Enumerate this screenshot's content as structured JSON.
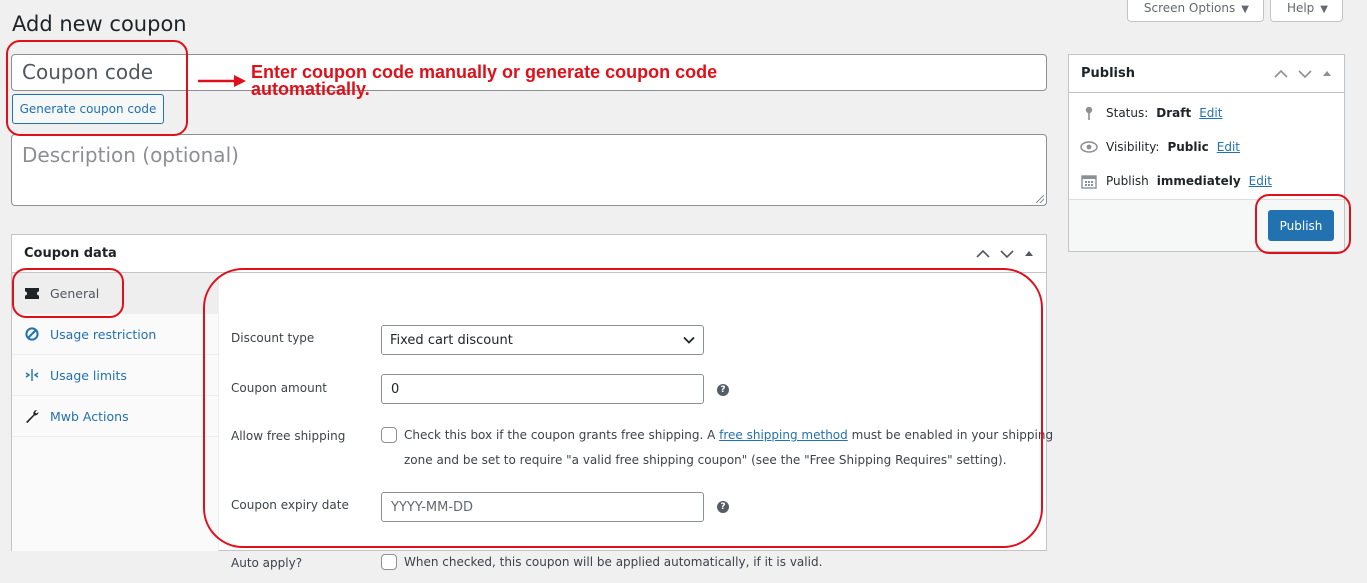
{
  "screen_options": {
    "label": "Screen Options",
    "caret": "▼"
  },
  "help": {
    "label": "Help",
    "caret": "▼"
  },
  "page_title": "Add new coupon",
  "coupon_code": {
    "placeholder": "Coupon code",
    "value": ""
  },
  "generate_button": "Generate coupon code",
  "description": {
    "placeholder": "Description (optional)",
    "value": ""
  },
  "annotation": {
    "text": "Enter coupon code manually or generate coupon code automatically.",
    "color": "#e0101a"
  },
  "publish": {
    "title": "Publish",
    "status_label": "Status:",
    "status_value": "Draft",
    "visibility_label": "Visibility:",
    "visibility_value": "Public",
    "publish_label": "Publish",
    "publish_value": "immediately",
    "edit_label": "Edit",
    "button": "Publish",
    "icons": [
      "pin-icon",
      "eye-icon",
      "calendar-icon"
    ]
  },
  "coupon_data": {
    "title": "Coupon data",
    "tabs": [
      {
        "label": "General",
        "icon": "ticket-icon",
        "active": true
      },
      {
        "label": "Usage restriction",
        "icon": "block-icon",
        "active": false
      },
      {
        "label": "Usage limits",
        "icon": "limits-icon",
        "active": false
      },
      {
        "label": "Mwb Actions",
        "icon": "wrench-icon",
        "active": false
      }
    ],
    "discount_type": {
      "label": "Discount type",
      "value": "Fixed cart discount"
    },
    "coupon_amount": {
      "label": "Coupon amount",
      "value": "0"
    },
    "free_shipping": {
      "label": "Allow free shipping",
      "text_before": "Check this box if the coupon grants free shipping. A ",
      "link": "free shipping method",
      "text_after": " must be enabled in your shipping zone and be set to require \"a valid free shipping coupon\" (see the \"Free Shipping Requires\" setting).",
      "checked": false
    },
    "expiry_date": {
      "label": "Coupon expiry date",
      "placeholder": "YYYY-MM-DD"
    },
    "auto_apply": {
      "label": "Auto apply?",
      "text": "When checked, this coupon will be applied automatically, if it is valid.",
      "checked": false
    }
  },
  "colors": {
    "accent": "#2271b1",
    "background": "#f0f0f1",
    "annotation": "#e0101a"
  }
}
